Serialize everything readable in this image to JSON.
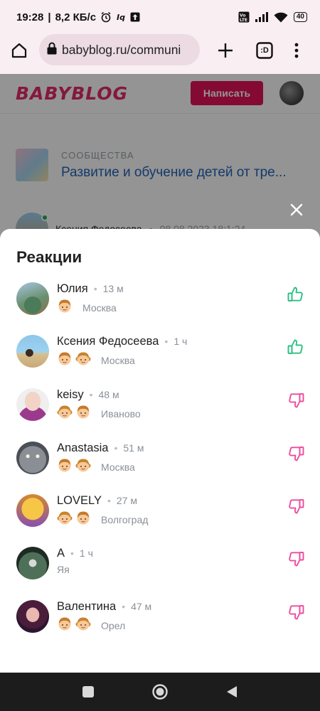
{
  "status_bar": {
    "time": "19:28",
    "speed": "8,2 КБ/с",
    "battery": "40"
  },
  "browser": {
    "url": "babyblog.ru/communi",
    "tab_count": ":D"
  },
  "site": {
    "logo": "BABYBLOG",
    "write_button": "Написать",
    "community_type": "СООБЩЕСТВА",
    "community_name": "Развитие и обучение детей от тре...",
    "post_author": "Ксения Федосеева",
    "post_date": "08.08.2023 18:1:24"
  },
  "reactions": {
    "title": "Реакции",
    "users": [
      {
        "name": "Юлия",
        "time": "13 м",
        "kids": [
          "boy"
        ],
        "city": "Москва",
        "reaction": "like",
        "avatar": "photo-outdoor"
      },
      {
        "name": "Ксения Федосеева",
        "time": "1 ч",
        "kids": [
          "boy",
          "girl"
        ],
        "city": "Москва",
        "reaction": "like",
        "avatar": "photo-beach"
      },
      {
        "name": "keisy",
        "time": "48 м",
        "kids": [
          "girl",
          "boy"
        ],
        "city": "Иваново",
        "reaction": "dislike",
        "avatar": "cartoon-sunglasses"
      },
      {
        "name": "Anastasia",
        "time": "51 м",
        "kids": [
          "boy",
          "girl"
        ],
        "city": "Москва",
        "reaction": "dislike",
        "avatar": "cat"
      },
      {
        "name": "LOVELY",
        "time": "27 м",
        "kids": [
          "girl",
          "boy"
        ],
        "city": "Волгоград",
        "reaction": "dislike",
        "avatar": "cartoon-yellow"
      },
      {
        "name": "А",
        "time": "1 ч",
        "kids": [],
        "city": "Яя",
        "reaction": "dislike",
        "avatar": "photo-dark"
      },
      {
        "name": "Валентина",
        "time": "47 м",
        "kids": [
          "boy",
          "girl"
        ],
        "city": "Орел",
        "reaction": "dislike",
        "avatar": "portrait-girl"
      }
    ]
  },
  "colors": {
    "like": "#2bbf82",
    "dislike": "#ec4d9c",
    "brand": "#e3125b",
    "link": "#2463b8"
  }
}
